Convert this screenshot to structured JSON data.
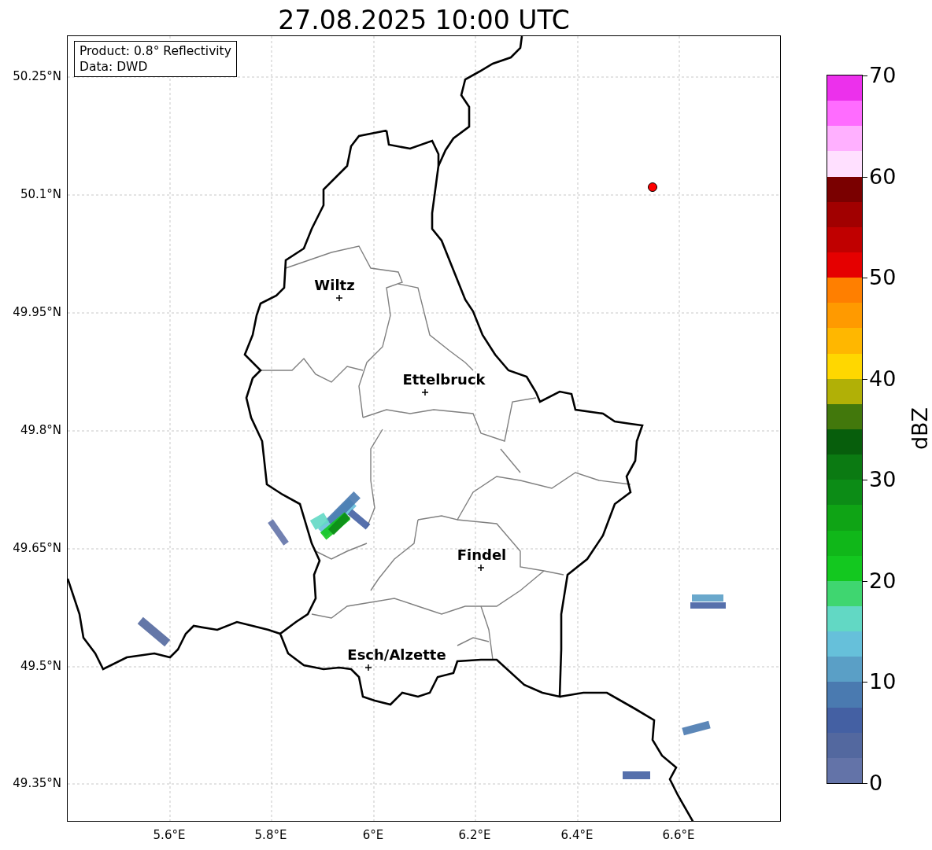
{
  "title": "27.08.2025 10:00 UTC",
  "info_box": {
    "lines": [
      "Product: 0.8° Reflectivity",
      "Data: DWD"
    ]
  },
  "map": {
    "y_ticks": [
      "50.25°N",
      "50.1°N",
      "49.95°N",
      "49.8°N",
      "49.65°N",
      "49.5°N",
      "49.35°N"
    ],
    "x_ticks": [
      "5.6°E",
      "5.8°E",
      "6°E",
      "6.2°E",
      "6.4°E",
      "6.6°E"
    ],
    "cities": [
      {
        "name": "Wiltz"
      },
      {
        "name": "Ettelbruck"
      },
      {
        "name": "Findel"
      },
      {
        "name": "Esch/Alzette"
      }
    ]
  },
  "colorbar": {
    "label": "dBZ",
    "ticks": [
      "70",
      "60",
      "50",
      "40",
      "30",
      "20",
      "10",
      "0"
    ],
    "segments": [
      {
        "color": "#6373a8"
      },
      {
        "color": "#53689f"
      },
      {
        "color": "#4460a3"
      },
      {
        "color": "#4a7ab0"
      },
      {
        "color": "#5a9fc6"
      },
      {
        "color": "#66c0da"
      },
      {
        "color": "#62d8c4"
      },
      {
        "color": "#3fd670"
      },
      {
        "color": "#13c81f"
      },
      {
        "color": "#10b719"
      },
      {
        "color": "#0fa415"
      },
      {
        "color": "#0c8c16"
      },
      {
        "color": "#0b7a12"
      },
      {
        "color": "#075e0c"
      },
      {
        "color": "#42780c"
      },
      {
        "color": "#b1b006"
      },
      {
        "color": "#ffd700"
      },
      {
        "color": "#ffb700"
      },
      {
        "color": "#ff9a00"
      },
      {
        "color": "#ff7f00"
      },
      {
        "color": "#e50000"
      },
      {
        "color": "#c00000"
      },
      {
        "color": "#a10000"
      },
      {
        "color": "#7a0000"
      },
      {
        "color": "#ffe0ff"
      },
      {
        "color": "#ffb0ff"
      },
      {
        "color": "#ff6cff"
      },
      {
        "color": "#ec30ec"
      }
    ]
  }
}
